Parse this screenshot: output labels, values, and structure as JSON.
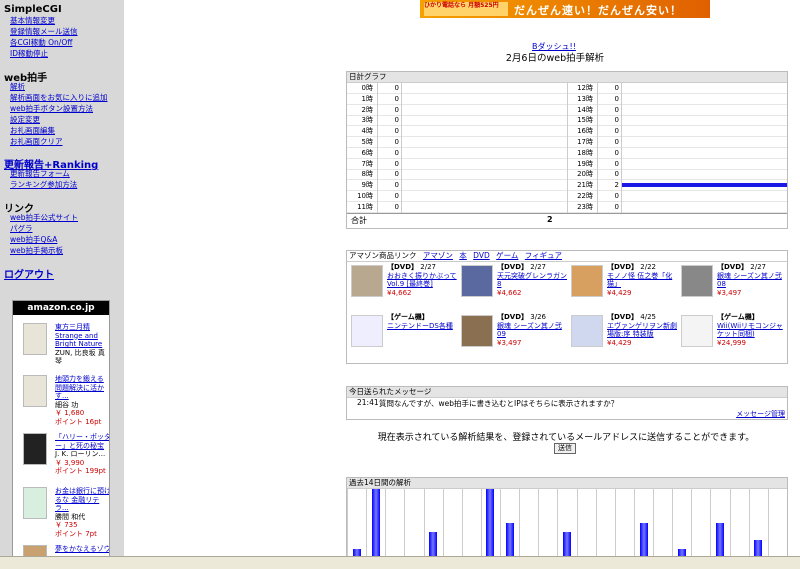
{
  "sidebar": {
    "sections": [
      {
        "title": "SimpleCGI",
        "items": [
          "基本情報変更",
          "登録情報メール送信",
          "各CGI稼動 On/Off",
          "ID稼動停止"
        ]
      },
      {
        "title": "web拍手",
        "items": [
          "解析",
          "解析画面をお気に入りに追加",
          "web拍手ボタン設置方法",
          "設定変更",
          "お礼画面編集",
          "お礼画面クリア"
        ]
      },
      {
        "title": "更新報告+Ranking",
        "items": [
          "更新報告フォーム",
          "ランキング参加方法"
        ]
      },
      {
        "title": "リンク",
        "items": [
          "web拍手公式サイト",
          "パグラ",
          "web拍手Q&A",
          "web拍手掲示板"
        ]
      }
    ],
    "logout": "ログアウト",
    "amazon": {
      "logo": "amazon.co.jp",
      "items": [
        {
          "title": "東方三月精 Strange and Bright Nature",
          "author": "ZUN, 比良坂 真琴",
          "price": "",
          "points": ""
        },
        {
          "title": "地頭力を鍛える 問題解決に活かす...",
          "author": "細谷 功",
          "price": "￥ 1,680",
          "points": "ポイント 16pt"
        },
        {
          "title": "「ハリー・ポッター」と死の秘宝",
          "author": "J. K. ローリン...",
          "price": "￥ 3,990",
          "points": "ポイント 199pt"
        },
        {
          "title": "お金は銀行に預けるな 金融リテラ...",
          "author": "勝間 和代",
          "price": "￥ 735",
          "points": "ポイント 7pt"
        },
        {
          "title": "夢をかなえるゾウ",
          "author": "",
          "price": "",
          "points": ""
        }
      ]
    }
  },
  "banner": {
    "small": "ひかり電話なら 月額525円",
    "text": "だんぜん速い！だんぜん安い！"
  },
  "header": {
    "link": "Bダッシュ!!",
    "title": "2月6日のweb拍手解析"
  },
  "hourly": {
    "heading": "日計グラフ",
    "hours": [
      {
        "label": "0時",
        "value": 0
      },
      {
        "label": "1時",
        "value": 0
      },
      {
        "label": "2時",
        "value": 0
      },
      {
        "label": "3時",
        "value": 0
      },
      {
        "label": "4時",
        "value": 0
      },
      {
        "label": "5時",
        "value": 0
      },
      {
        "label": "6時",
        "value": 0
      },
      {
        "label": "7時",
        "value": 0
      },
      {
        "label": "8時",
        "value": 0
      },
      {
        "label": "9時",
        "value": 0
      },
      {
        "label": "10時",
        "value": 0
      },
      {
        "label": "11時",
        "value": 0
      },
      {
        "label": "12時",
        "value": 0
      },
      {
        "label": "13時",
        "value": 0
      },
      {
        "label": "14時",
        "value": 0
      },
      {
        "label": "15時",
        "value": 0
      },
      {
        "label": "16時",
        "value": 0
      },
      {
        "label": "17時",
        "value": 0
      },
      {
        "label": "18時",
        "value": 0
      },
      {
        "label": "19時",
        "value": 0
      },
      {
        "label": "20時",
        "value": 0
      },
      {
        "label": "21時",
        "value": 2
      },
      {
        "label": "22時",
        "value": 0
      },
      {
        "label": "23時",
        "value": 0
      }
    ],
    "total_label": "合計",
    "total_value": "2"
  },
  "amazon_links": {
    "heading": "アマゾン商品リンク",
    "tabs": [
      "アマゾン",
      "本",
      "DVD",
      "ゲーム",
      "フィギュア"
    ],
    "products": [
      {
        "cat": "【DVD】",
        "date": "2/27",
        "name": "おおきく振りかぶって Vol.9 [最終巻]",
        "price": "¥4,662"
      },
      {
        "cat": "【DVD】",
        "date": "2/27",
        "name": "天元突破グレンラガン 8",
        "price": "¥4,662"
      },
      {
        "cat": "【DVD】",
        "date": "2/22",
        "name": "モノノ怪 伍之巻「化猫」",
        "price": "¥4,429"
      },
      {
        "cat": "【DVD】",
        "date": "2/27",
        "name": "銀魂 シーズン其ノ弐 08",
        "price": "¥3,497"
      },
      {
        "cat": "【ゲーム機】",
        "date": "",
        "name": "ニンテンドーDS各種",
        "price": ""
      },
      {
        "cat": "【DVD】",
        "date": "3/26",
        "name": "銀魂 シーズン其ノ弐 09",
        "price": "¥3,497"
      },
      {
        "cat": "【DVD】",
        "date": "4/25",
        "name": "エヴァンゲリヲン新劇場版:序 特装版",
        "price": "¥4,429"
      },
      {
        "cat": "【ゲーム機】",
        "date": "",
        "name": "Wii(Wiiリモコンジャケット同梱)",
        "price": "¥24,999"
      }
    ]
  },
  "messages": {
    "heading": "今日送られたメッセージ",
    "items": [
      {
        "time": "21:41",
        "text": "質問なんですが、web拍手に書き込むとIPはそちらに表示されますか？"
      }
    ],
    "manage_link": "メッセージ管理"
  },
  "send": {
    "text": "現在表示されている解析結果を、登録されているメールアドレスに送信することができます。",
    "button": "送信"
  },
  "daily": {
    "heading": "過去14日間の解析",
    "values": [
      1,
      8,
      0,
      0,
      3,
      0,
      0,
      8,
      4,
      0,
      0,
      3,
      0,
      0,
      0,
      4,
      0,
      1,
      0,
      4,
      0,
      2,
      0
    ]
  },
  "colors": {
    "bar": "#1a1ae6",
    "sidebar_bg": "#d8d8d8",
    "link": "#0000cc",
    "price": "#cc0000"
  }
}
